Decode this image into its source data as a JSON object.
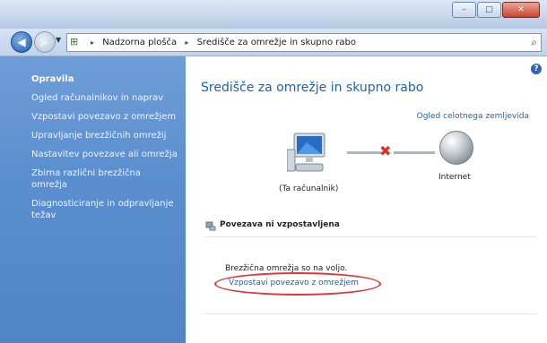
{
  "titlebar": {
    "minimize_glyph": "–",
    "maximize_glyph": "□",
    "close_glyph": "✕"
  },
  "navbar": {
    "back_icon": "back-arrow-icon",
    "forward_icon": "forward-arrow-icon",
    "address_icon": "network-folder-icon",
    "breadcrumb": [
      "Nadzorna plošča",
      "Središče za omrežje in skupno rabo"
    ],
    "separator": "▸",
    "search_icon": "search-icon"
  },
  "sidebar": {
    "heading": "Opravila",
    "items": [
      {
        "label": "Ogled računalnikov in naprav"
      },
      {
        "label": "Vzpostavi povezavo z omrežjem"
      },
      {
        "label": "Upravljanje brezžičnih omrežij"
      },
      {
        "label": "Nastavitev povezave ali omrežja"
      },
      {
        "label": "Zbirna različni brezžična omrežja"
      },
      {
        "label": "Diagnosticiranje in odpravljanje težav"
      }
    ]
  },
  "main": {
    "help_glyph": "?",
    "title": "Središče za omrežje in skupno rabo",
    "map_link": "Ogled celotnega zemljevida",
    "computer_label": "(Ta računalnik)",
    "internet_label": "Internet",
    "section_title": "Povezava ni vzpostavljena",
    "status_text": "Brezžična omrežja so na voljo.",
    "connect_link": "Vzpostavi povezavo z omrežjem"
  },
  "colors": {
    "accent": "#2361a8",
    "sidebar": "#5c8fcf",
    "error": "#e03020",
    "highlight": "#e0363a"
  }
}
